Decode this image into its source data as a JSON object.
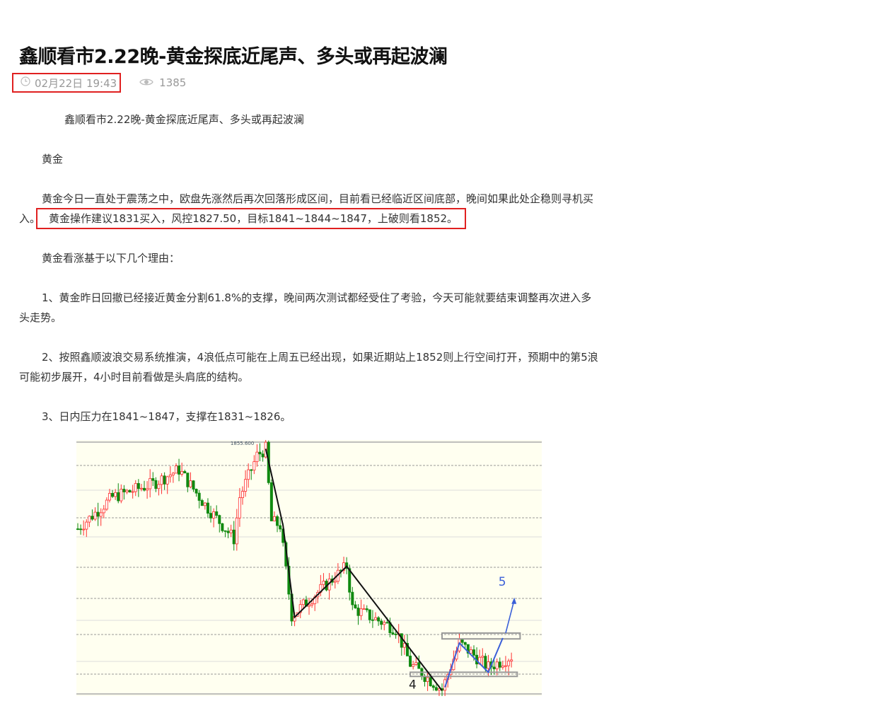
{
  "article": {
    "title": "鑫顺看市2.22晚-黄金探底近尾声、多头或再起波澜",
    "date": "02月22日 19:43",
    "views": "1385",
    "paragraphs": {
      "p0": "鑫顺看市2.22晚-黄金探底近尾声、多头或再起波澜",
      "p1": "黄金",
      "p2a": "黄金今日一直处于震荡之中，欧盘先涨然后再次回落形成区间，目前看已经临近区间底部，晚间如果此处企稳则寻机买入。",
      "p2b": "黄金操作建议1831买入，风控1827.50，目标1841~1844~1847，上破则看1852。",
      "p3": "黄金看涨基于以下几个理由：",
      "p4": "1、黄金昨日回撤已经接近黄金分割61.8%的支撑，晚间两次测试都经受住了考验，今天可能就要结束调整再次进入多头走势。",
      "p5": "2、按照鑫顺波浪交易系统推演，4浪低点可能在上周五已经出现，如果近期站上1852则上行空间打开，预期中的第5浪可能初步展开，4小时目前看做是头肩底的结构。",
      "p6": "3、日内压力在1841~1847，支撑在1831~1826。"
    }
  },
  "chart_data": {
    "type": "candlestick",
    "title": "",
    "high_label": "1855.600",
    "ylim": [
      1825.8,
      1856.0
    ],
    "xlim": [
      0,
      160
    ],
    "path": [
      [
        0,
        1845.6
      ],
      [
        12,
        1849.4
      ],
      [
        26,
        1851.0
      ],
      [
        35,
        1852.7
      ],
      [
        44,
        1848.5
      ],
      [
        54,
        1844.4
      ],
      [
        56,
        1849.4
      ],
      [
        62,
        1854.4
      ],
      [
        65,
        1855.2
      ],
      [
        67,
        1846.5
      ],
      [
        70,
        1846.0
      ],
      [
        74,
        1835.2
      ],
      [
        93,
        1841.1
      ],
      [
        95,
        1836.1
      ],
      [
        110,
        1833.6
      ],
      [
        115,
        1829.4
      ],
      [
        126,
        1826.3
      ],
      [
        132,
        1831.9
      ],
      [
        142,
        1829.0
      ],
      [
        150,
        1830.3
      ]
    ],
    "wave_black": [
      [
        65,
        1855.2
      ],
      [
        71,
        1846.0
      ],
      [
        75,
        1835.0
      ],
      [
        93,
        1841.1
      ],
      [
        126,
        1826.2
      ]
    ],
    "wave_blue": [
      [
        127,
        1826.6
      ],
      [
        132,
        1831.9
      ],
      [
        142,
        1828.4
      ],
      [
        147,
        1832.5
      ]
    ],
    "arrow_blue": [
      [
        148,
        1833.1
      ],
      [
        151,
        1837.1
      ]
    ],
    "zones": [
      [
        126,
        153,
        1832.4,
        1833.1
      ],
      [
        115,
        152,
        1827.9,
        1828.4
      ]
    ],
    "labels": {
      "wave4": "4",
      "wave5": "5"
    },
    "colors": {
      "up": "#ff3030",
      "down": "#108a10",
      "bg": "#fffff0",
      "blue": "#3a5fd8"
    }
  }
}
